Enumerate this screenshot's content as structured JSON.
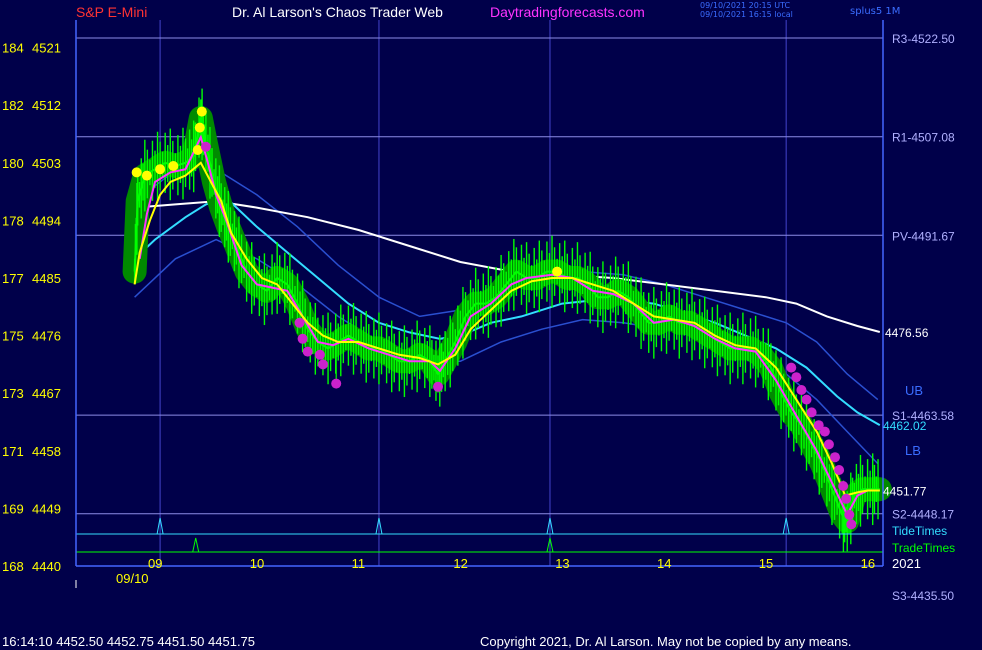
{
  "header": {
    "symbol": "S&P E-Mini",
    "title": "Dr. Al Larson's Chaos Trader Web",
    "site": "Daytradingforecasts.com",
    "timestamp_utc": "09/10/2021 20:15 UTC",
    "timestamp_local": "09/10/2021 16:15 local",
    "interval": "splus5 1M"
  },
  "footer": {
    "quote": "16:14:10  4452.50 4452.75 4451.50 4451.75",
    "copyright": "Copyright 2021, Dr. Al Larson. May not be copied by any means."
  },
  "colors": {
    "background": "#00004a",
    "price_bars": "#00ff00",
    "halo": "#008a00",
    "yellow_line": "#ffff00",
    "magenta_line": "#ff33ff",
    "white_avg": "#ffffff",
    "cyan_avg": "#33ddff",
    "band": "#2a4fd0",
    "level_lines": "#8c8ce6",
    "time_grid": "#4444cc",
    "left_labels": "#ffff00"
  },
  "chart_data": {
    "type": "line",
    "title": "S&P E-Mini",
    "date_label": "09/10",
    "year_label": "2021",
    "x_ticks": [
      "09",
      "10",
      "11",
      "12",
      "13",
      "14",
      "15",
      "16"
    ],
    "left_axis": [
      {
        "cycle": "184",
        "price": "4521"
      },
      {
        "cycle": "182",
        "price": "4512"
      },
      {
        "cycle": "180",
        "price": "4503"
      },
      {
        "cycle": "178",
        "price": "4494"
      },
      {
        "cycle": "177",
        "price": "4485"
      },
      {
        "cycle": "175",
        "price": "4476"
      },
      {
        "cycle": "173",
        "price": "4467"
      },
      {
        "cycle": "171",
        "price": "4458"
      },
      {
        "cycle": "169",
        "price": "4449"
      },
      {
        "cycle": "168",
        "price": "4440"
      }
    ],
    "price_range": [
      4440,
      4524
    ],
    "time_range": [
      8.8,
      16.15
    ],
    "levels": [
      {
        "label": "R3-4522.50",
        "value": 4522.5
      },
      {
        "label": "R1-4507.08",
        "value": 4507.08
      },
      {
        "label": "PV-4491.67",
        "value": 4491.67
      },
      {
        "label": "S1-4463.58",
        "value": 4463.58
      },
      {
        "label": "S2-4448.17",
        "value": 4448.17
      },
      {
        "label": "S3-4435.50",
        "value": 4435.5
      }
    ],
    "value_labels": [
      {
        "label": "4476.56",
        "value": 4476.56
      },
      {
        "label": "4462.02",
        "value": 4462.02
      },
      {
        "label": "4451.77",
        "value": 4451.77
      }
    ],
    "band_labels": {
      "upper": "UB",
      "lower": "LB"
    },
    "tide_label": "TideTimes",
    "trade_label": "TradeTimes",
    "tide_times": [
      9.05,
      11.2,
      12.88,
      15.2
    ],
    "trade_times": [
      9.4,
      12.88
    ],
    "price_series": [
      [
        8.8,
        4486
      ],
      [
        8.83,
        4497
      ],
      [
        8.9,
        4501
      ],
      [
        9.0,
        4502
      ],
      [
        9.1,
        4503
      ],
      [
        9.2,
        4502.5
      ],
      [
        9.3,
        4503
      ],
      [
        9.38,
        4504
      ],
      [
        9.45,
        4510
      ],
      [
        9.5,
        4506
      ],
      [
        9.58,
        4500
      ],
      [
        9.65,
        4496
      ],
      [
        9.72,
        4493
      ],
      [
        9.8,
        4490
      ],
      [
        9.9,
        4486
      ],
      [
        10.0,
        4484
      ],
      [
        10.1,
        4483
      ],
      [
        10.2,
        4485
      ],
      [
        10.3,
        4484
      ],
      [
        10.4,
        4481
      ],
      [
        10.5,
        4477
      ],
      [
        10.6,
        4475
      ],
      [
        10.7,
        4474
      ],
      [
        10.8,
        4475
      ],
      [
        10.9,
        4476
      ],
      [
        11.0,
        4475
      ],
      [
        11.1,
        4474
      ],
      [
        11.2,
        4474
      ],
      [
        11.3,
        4473
      ],
      [
        11.4,
        4472
      ],
      [
        11.5,
        4472
      ],
      [
        11.6,
        4473
      ],
      [
        11.7,
        4472
      ],
      [
        11.78,
        4470
      ],
      [
        11.85,
        4472
      ],
      [
        11.95,
        4475
      ],
      [
        12.05,
        4479
      ],
      [
        12.15,
        4481
      ],
      [
        12.25,
        4481
      ],
      [
        12.35,
        4482
      ],
      [
        12.45,
        4484
      ],
      [
        12.55,
        4486
      ],
      [
        12.65,
        4485
      ],
      [
        12.75,
        4485
      ],
      [
        12.85,
        4486
      ],
      [
        12.95,
        4486
      ],
      [
        13.05,
        4485
      ],
      [
        13.15,
        4485
      ],
      [
        13.25,
        4484
      ],
      [
        13.35,
        4482
      ],
      [
        13.45,
        4482
      ],
      [
        13.55,
        4483
      ],
      [
        13.65,
        4482
      ],
      [
        13.75,
        4480
      ],
      [
        13.85,
        4478
      ],
      [
        13.95,
        4478
      ],
      [
        14.05,
        4479
      ],
      [
        14.15,
        4478
      ],
      [
        14.25,
        4478
      ],
      [
        14.35,
        4477
      ],
      [
        14.45,
        4476
      ],
      [
        14.55,
        4475
      ],
      [
        14.65,
        4474
      ],
      [
        14.75,
        4474
      ],
      [
        14.85,
        4474
      ],
      [
        14.95,
        4473
      ],
      [
        15.05,
        4471
      ],
      [
        15.15,
        4467
      ],
      [
        15.25,
        4464
      ],
      [
        15.35,
        4462
      ],
      [
        15.45,
        4459
      ],
      [
        15.55,
        4456
      ],
      [
        15.65,
        4452
      ],
      [
        15.75,
        4448
      ],
      [
        15.8,
        4447
      ],
      [
        15.87,
        4451
      ],
      [
        15.95,
        4452
      ],
      [
        16.05,
        4452
      ],
      [
        16.12,
        4452
      ]
    ],
    "yellow_line": [
      [
        8.8,
        4484
      ],
      [
        8.85,
        4489
      ],
      [
        8.95,
        4494
      ],
      [
        9.05,
        4498
      ],
      [
        9.15,
        4500
      ],
      [
        9.3,
        4501
      ],
      [
        9.45,
        4503
      ],
      [
        9.55,
        4500
      ],
      [
        9.65,
        4497
      ],
      [
        9.75,
        4492
      ],
      [
        9.9,
        4488
      ],
      [
        10.05,
        4485
      ],
      [
        10.2,
        4484
      ],
      [
        10.35,
        4481
      ],
      [
        10.5,
        4478
      ],
      [
        10.65,
        4476
      ],
      [
        10.8,
        4475
      ],
      [
        11.0,
        4475
      ],
      [
        11.2,
        4474
      ],
      [
        11.4,
        4473
      ],
      [
        11.6,
        4472.5
      ],
      [
        11.78,
        4471.5
      ],
      [
        11.95,
        4473
      ],
      [
        12.1,
        4477
      ],
      [
        12.3,
        4480
      ],
      [
        12.5,
        4483
      ],
      [
        12.7,
        4484.5
      ],
      [
        12.9,
        4485
      ],
      [
        13.1,
        4485
      ],
      [
        13.3,
        4484
      ],
      [
        13.5,
        4483
      ],
      [
        13.7,
        4481
      ],
      [
        13.9,
        4479
      ],
      [
        14.1,
        4478.5
      ],
      [
        14.3,
        4478
      ],
      [
        14.5,
        4476
      ],
      [
        14.7,
        4474.5
      ],
      [
        14.9,
        4474
      ],
      [
        15.1,
        4471
      ],
      [
        15.3,
        4466
      ],
      [
        15.5,
        4461
      ],
      [
        15.65,
        4456
      ],
      [
        15.78,
        4451
      ],
      [
        15.9,
        4451.5
      ],
      [
        16.0,
        4451.8
      ],
      [
        16.12,
        4451.8
      ]
    ],
    "magenta_line": [
      [
        8.85,
        4488
      ],
      [
        8.92,
        4495
      ],
      [
        9.0,
        4500
      ],
      [
        9.15,
        4501.5
      ],
      [
        9.3,
        4502
      ],
      [
        9.45,
        4507
      ],
      [
        9.52,
        4503
      ],
      [
        9.6,
        4498
      ],
      [
        9.7,
        4494
      ],
      [
        9.85,
        4487
      ],
      [
        10.0,
        4484
      ],
      [
        10.15,
        4483.5
      ],
      [
        10.3,
        4483
      ],
      [
        10.45,
        4479
      ],
      [
        10.6,
        4475
      ],
      [
        10.75,
        4474.5
      ],
      [
        10.9,
        4475.5
      ],
      [
        11.1,
        4474
      ],
      [
        11.3,
        4473
      ],
      [
        11.5,
        4472
      ],
      [
        11.7,
        4472
      ],
      [
        11.8,
        4470.5
      ],
      [
        11.95,
        4474
      ],
      [
        12.1,
        4479
      ],
      [
        12.3,
        4481
      ],
      [
        12.5,
        4484
      ],
      [
        12.65,
        4485
      ],
      [
        12.9,
        4485.5
      ],
      [
        13.1,
        4485
      ],
      [
        13.3,
        4483
      ],
      [
        13.5,
        4482.5
      ],
      [
        13.7,
        4481
      ],
      [
        13.9,
        4478
      ],
      [
        14.1,
        4478.5
      ],
      [
        14.3,
        4477.5
      ],
      [
        14.5,
        4475.5
      ],
      [
        14.7,
        4474
      ],
      [
        14.9,
        4473.5
      ],
      [
        15.1,
        4469
      ],
      [
        15.3,
        4463.5
      ],
      [
        15.5,
        4458
      ],
      [
        15.65,
        4453
      ],
      [
        15.8,
        4448
      ],
      [
        15.9,
        4451
      ],
      [
        16.0,
        4451.8
      ],
      [
        16.12,
        4451.8
      ]
    ],
    "white_avg": [
      [
        8.8,
        4496
      ],
      [
        9.2,
        4496.5
      ],
      [
        9.6,
        4497
      ],
      [
        10.0,
        4496
      ],
      [
        10.5,
        4494.5
      ],
      [
        11.0,
        4492.5
      ],
      [
        11.5,
        4490
      ],
      [
        12.0,
        4487.5
      ],
      [
        12.5,
        4486
      ],
      [
        13.0,
        4485.5
      ],
      [
        13.5,
        4485
      ],
      [
        14.0,
        4484
      ],
      [
        14.5,
        4483
      ],
      [
        15.0,
        4482
      ],
      [
        15.3,
        4481
      ],
      [
        15.6,
        4479
      ],
      [
        15.9,
        4477.5
      ],
      [
        16.12,
        4476.56
      ]
    ],
    "cyan_avg": [
      [
        8.8,
        4488
      ],
      [
        9.0,
        4491
      ],
      [
        9.3,
        4494.5
      ],
      [
        9.5,
        4496.5
      ],
      [
        9.7,
        4497.5
      ],
      [
        10.0,
        4493
      ],
      [
        10.3,
        4489
      ],
      [
        10.6,
        4485
      ],
      [
        10.9,
        4481
      ],
      [
        11.2,
        4478
      ],
      [
        11.5,
        4476.5
      ],
      [
        11.8,
        4475.5
      ],
      [
        12.0,
        4476
      ],
      [
        12.3,
        4478
      ],
      [
        12.6,
        4479
      ],
      [
        13.0,
        4481
      ],
      [
        13.3,
        4481.5
      ],
      [
        13.6,
        4481.5
      ],
      [
        13.9,
        4481
      ],
      [
        14.2,
        4479.5
      ],
      [
        14.5,
        4478
      ],
      [
        14.8,
        4476
      ],
      [
        15.1,
        4474
      ],
      [
        15.4,
        4471
      ],
      [
        15.7,
        4466.5
      ],
      [
        15.9,
        4464
      ],
      [
        16.12,
        4462.02
      ]
    ],
    "upper_band": [
      [
        8.8,
        4497
      ],
      [
        9.3,
        4503
      ],
      [
        9.6,
        4502
      ],
      [
        10.0,
        4498
      ],
      [
        10.4,
        4493
      ],
      [
        10.8,
        4487
      ],
      [
        11.2,
        4482
      ],
      [
        11.6,
        4479
      ],
      [
        12.0,
        4480
      ],
      [
        12.4,
        4483
      ],
      [
        12.8,
        4485
      ],
      [
        13.2,
        4486
      ],
      [
        13.6,
        4485.5
      ],
      [
        14.0,
        4484
      ],
      [
        14.4,
        4482
      ],
      [
        14.8,
        4480
      ],
      [
        15.2,
        4478
      ],
      [
        15.5,
        4475
      ],
      [
        15.8,
        4470
      ],
      [
        16.1,
        4466
      ]
    ],
    "lower_band": [
      [
        8.8,
        4482
      ],
      [
        9.2,
        4488
      ],
      [
        9.6,
        4491
      ],
      [
        10.0,
        4488
      ],
      [
        10.4,
        4484
      ],
      [
        10.8,
        4479
      ],
      [
        11.2,
        4475
      ],
      [
        11.6,
        4472
      ],
      [
        12.0,
        4472
      ],
      [
        12.4,
        4475
      ],
      [
        12.8,
        4477
      ],
      [
        13.2,
        4478.5
      ],
      [
        13.6,
        4478
      ],
      [
        14.0,
        4477
      ],
      [
        14.4,
        4475.5
      ],
      [
        14.8,
        4473
      ],
      [
        15.2,
        4470
      ],
      [
        15.5,
        4466
      ],
      [
        15.8,
        4461
      ],
      [
        16.1,
        4456
      ]
    ],
    "yellow_dots": [
      [
        8.82,
        4501.5
      ],
      [
        8.92,
        4501
      ],
      [
        9.05,
        4502
      ],
      [
        9.18,
        4502.5
      ],
      [
        9.42,
        4505
      ],
      [
        9.44,
        4508.5
      ],
      [
        9.46,
        4511
      ],
      [
        12.95,
        4486
      ]
    ],
    "magenta_dots": [
      [
        9.5,
        4505.5
      ],
      [
        10.42,
        4478
      ],
      [
        10.45,
        4475.5
      ],
      [
        10.5,
        4473.5
      ],
      [
        10.62,
        4473
      ],
      [
        10.65,
        4471.5
      ],
      [
        10.78,
        4468.5
      ],
      [
        11.78,
        4468
      ],
      [
        15.25,
        4471
      ],
      [
        15.3,
        4469.5
      ],
      [
        15.35,
        4467.5
      ],
      [
        15.4,
        4466
      ],
      [
        15.45,
        4464
      ],
      [
        15.52,
        4462
      ],
      [
        15.58,
        4461
      ],
      [
        15.62,
        4459
      ],
      [
        15.68,
        4457
      ],
      [
        15.72,
        4455
      ],
      [
        15.76,
        4452.5
      ],
      [
        15.79,
        4450.5
      ],
      [
        15.82,
        4448
      ],
      [
        15.84,
        4446.5
      ]
    ]
  }
}
